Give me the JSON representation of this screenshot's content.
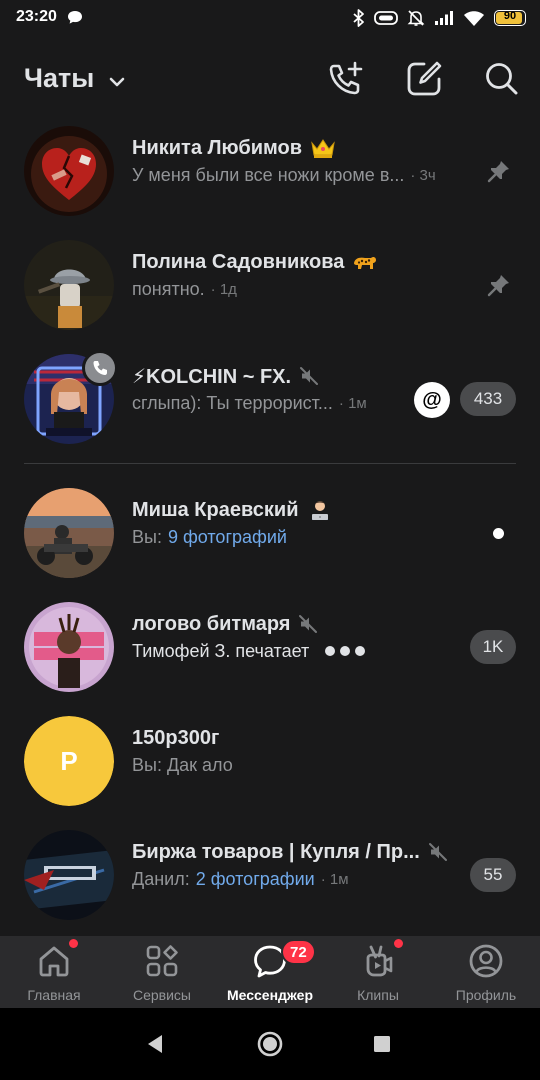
{
  "status_bar": {
    "time": "23:20",
    "battery": "90",
    "battery_level": 0.9,
    "icons": [
      "chat-bubble-icon",
      "bluetooth-icon",
      "vibrate-icon",
      "mute-bell-icon",
      "signal-icon",
      "wifi-icon",
      "battery-icon"
    ]
  },
  "header": {
    "title": "Чаты",
    "actions": [
      "new-call-icon",
      "compose-icon",
      "search-icon"
    ]
  },
  "chats": [
    {
      "name": "Никита Любимов",
      "emoji": "crown",
      "preview": "У меня были все ножи кроме в...",
      "time": "· 3ч",
      "pinned": true
    },
    {
      "name": "Полина Садовникова",
      "emoji": "leopard",
      "preview": "понятно.",
      "time": "· 1д",
      "pinned": true
    },
    {
      "name": "⚡KOLCHIN ~ FX.",
      "muted": true,
      "call_active": true,
      "preview": "сглыпа): Ты террорист...",
      "time": "· 1м",
      "mention": "@",
      "counter": "433"
    },
    {
      "name": "Миша Краевский",
      "emoji": "technologist",
      "preview_prefix": "Вы:",
      "preview_link": "9 фотографий",
      "unread": true
    },
    {
      "name": "логово битмаря",
      "muted": true,
      "preview": "Тимофей З. печатает",
      "typing": true,
      "counter": "1K"
    },
    {
      "name": "150р300г",
      "avatar_letter": "P",
      "avatar_color": "#f7c83c",
      "preview": "Вы: Дак ало"
    },
    {
      "name": "Биржа товаров | Купля / Пр...",
      "muted": true,
      "preview_prefix": "Данил:",
      "preview_link": "2 фотографии",
      "time": "· 1м",
      "counter": "55"
    }
  ],
  "tabbar": {
    "tabs": [
      {
        "label": "Главная",
        "icon": "home-icon",
        "dot": true
      },
      {
        "label": "Сервисы",
        "icon": "services-icon"
      },
      {
        "label": "Мессенджер",
        "icon": "messenger-icon",
        "active": true,
        "badge": "72"
      },
      {
        "label": "Клипы",
        "icon": "clips-icon",
        "dot": true
      },
      {
        "label": "Профиль",
        "icon": "profile-icon"
      }
    ]
  },
  "colors": {
    "background": "#19191a",
    "tabbar": "#2b2b2d",
    "text_primary": "#e1e3e6",
    "text_secondary": "#939598",
    "link": "#71aaeb",
    "badge_red": "#ff3347",
    "counter_bg": "#4a4b4d"
  }
}
